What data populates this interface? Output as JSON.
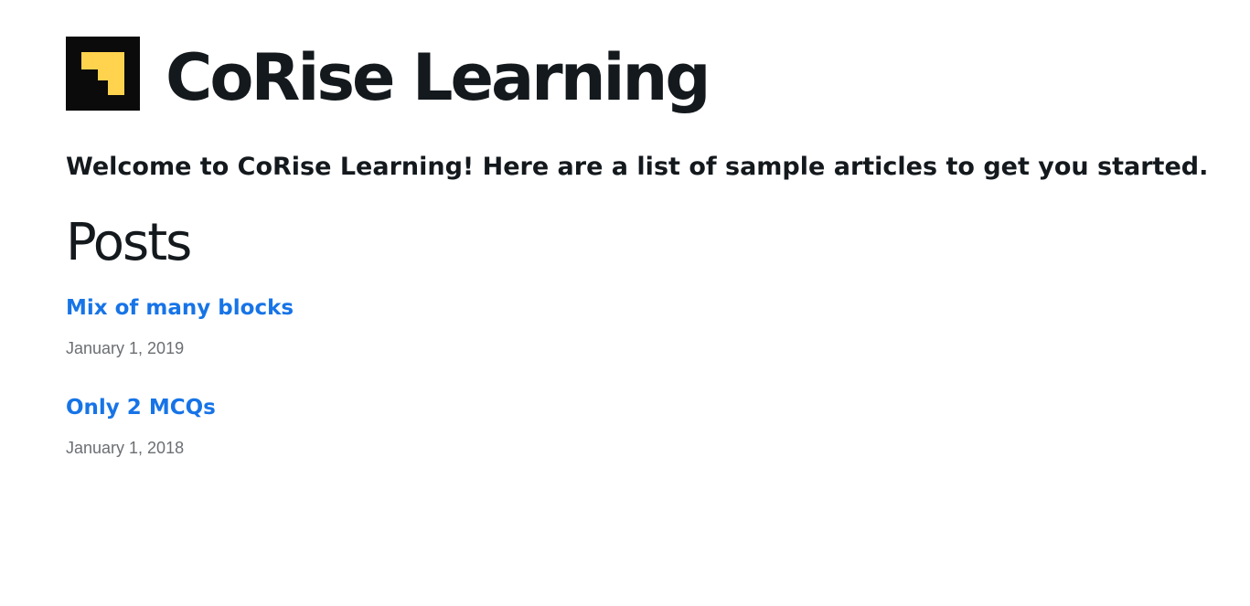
{
  "header": {
    "logo_icon": "corise-logo-icon",
    "logo_colors": {
      "background": "#0b0b0b",
      "accent": "#ffd34e"
    },
    "site_title": "CoRise Learning"
  },
  "intro": {
    "text": "Welcome to CoRise Learning! Here are a list of sample articles to get you started."
  },
  "posts": {
    "heading": "Posts",
    "items": [
      {
        "title": "Mix of many blocks",
        "date": "January 1, 2019"
      },
      {
        "title": "Only 2 MCQs",
        "date": "January 1, 2018"
      }
    ]
  },
  "colors": {
    "text": "#14191d",
    "link": "#1774e7",
    "date": "#6b6f73"
  }
}
